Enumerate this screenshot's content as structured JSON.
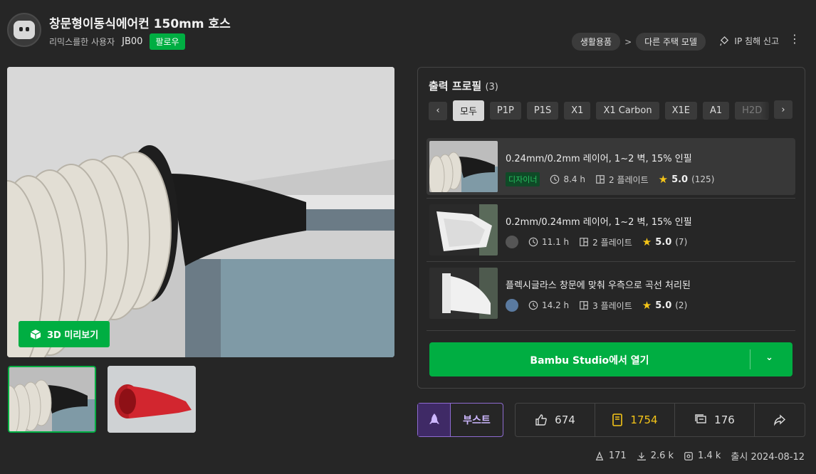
{
  "header": {
    "title": "창문형이동식에어컨 150mm 호스",
    "user_desc": "리믹스를한 사용자",
    "username": "JB00",
    "follow_label": "팔로우",
    "breadcrumbs": [
      "생활용품",
      "다른 주택 모델"
    ],
    "crumb_separator": ">",
    "report_label": "IP 침해 신고",
    "more_icon": "⋮"
  },
  "gallery": {
    "preview_3d_label": "3D 미리보기"
  },
  "profiles": {
    "title": "출력 프로필",
    "count": "(3)",
    "tabs": [
      "모두",
      "P1P",
      "P1S",
      "X1",
      "X1 Carbon",
      "X1E",
      "A1",
      "H2D"
    ],
    "items": [
      {
        "name": "0.24mm/0.2mm 레이어, 1~2 벽, 15% 인필",
        "badge": "디자이너",
        "time": "8.4 h",
        "plates": "2 플레이트",
        "rating": "5.0",
        "reviews": "(125)"
      },
      {
        "name": "0.2mm/0.24mm 레이어, 1~2 벽, 15% 인필",
        "time": "11.1 h",
        "plates": "2 플레이트",
        "rating": "5.0",
        "reviews": "(7)"
      },
      {
        "name": "플렉시글라스 창문에 맞춰 우측으로 곡선 처리된",
        "time": "14.2 h",
        "plates": "3 플레이트",
        "rating": "5.0",
        "reviews": "(2)"
      }
    ],
    "open_label": "Bambu Studio에서 열기"
  },
  "actions": {
    "boost_label": "부스트",
    "likes": "674",
    "collects": "1754",
    "comments": "176"
  },
  "stats": {
    "prints": "171",
    "downloads": "2.6 k",
    "views": "1.4 k",
    "published": "출시 2024-08-12"
  },
  "colors": {
    "accent": "#00ae42",
    "boost": "#8e6bd1",
    "gold": "#f5c518"
  }
}
